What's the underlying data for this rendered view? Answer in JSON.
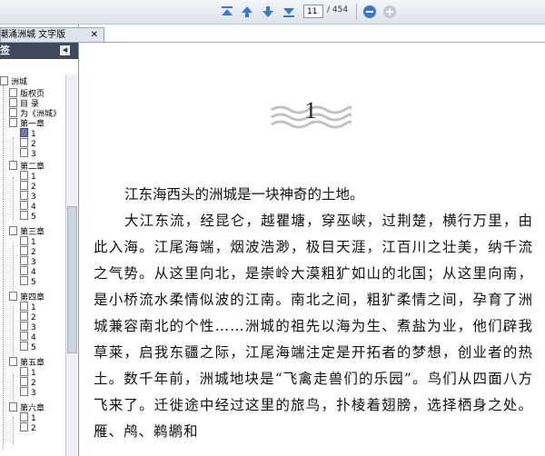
{
  "toolbar": {
    "current_page": "11",
    "total_pages": "/ 454",
    "icons": [
      "first-page-icon",
      "previous-page-icon",
      "next-page-icon",
      "last-page-icon",
      "zoom-in-icon",
      "zoom-out-icon"
    ]
  },
  "tab": {
    "title": "潮涌洲城 文字版",
    "close": "✕"
  },
  "panel": {
    "header": "签",
    "collapse": "◀"
  },
  "tree": {
    "root": "洲城",
    "items": [
      "版权页",
      "目  录",
      "为《洲城》",
      "第一章",
      "1",
      "2",
      "3",
      "第二章",
      "1",
      "2",
      "3",
      "4",
      "5",
      "第三章",
      "1",
      "2",
      "3",
      "4",
      "5",
      "第四章",
      "1",
      "2",
      "3",
      "4",
      "5",
      "第五章",
      "1",
      "2",
      "3",
      "第六章",
      "1",
      "2"
    ]
  },
  "chapter": {
    "number": "1"
  },
  "content": {
    "p1": "江东海西头的洲城是一块神奇的土地。",
    "p2": "大江东流，经昆仑，越瞿塘，穿巫峡，过荆楚，横行万里，由此入海。江尾海端，烟波浩渺，极目天涯，江百川之壮美，纳千流之气势。从这里向北，是崇岭大漠粗犷如山的北国；从这里向南，是小桥流水柔情似波的江南。南北之间，粗犷柔情之间，孕育了洲城兼容南北的个性……洲城的祖先以海为生、煮盐为业，他们辟我草莱，启我东疆之际，江尾海端注定是开拓者的梦想，创业者的热土。数千年前，洲城地块是“飞禽走兽们的乐园”。鸟们从四面八方飞来了。迁徙途中经过这里的旅鸟，扑棱着翅膀，选择栖身之处。雁、鸬、鹈鹕和"
  },
  "colors": {
    "toolbar_icon": "#3a78c8",
    "panel_header": "#3e4a5c"
  }
}
